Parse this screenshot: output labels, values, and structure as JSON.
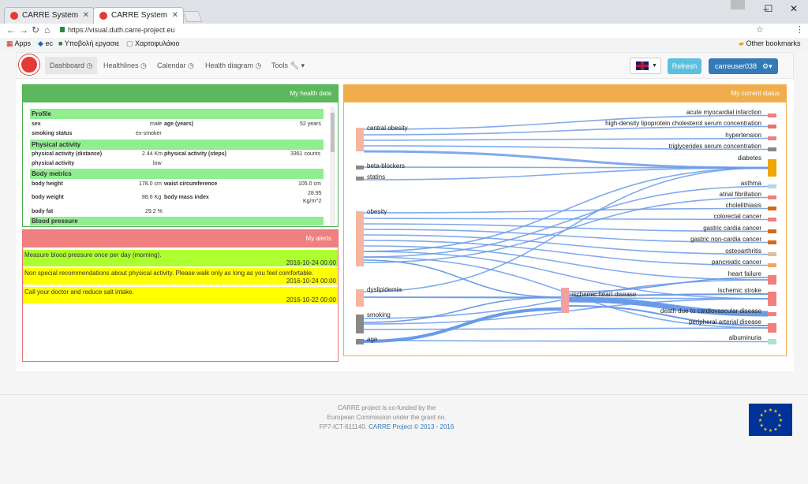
{
  "browser": {
    "tabs": [
      {
        "title": "CARRE System",
        "active": false
      },
      {
        "title": "CARRE System",
        "active": true
      }
    ],
    "url": "https://visual.duth.carre-project.eu",
    "bookmarks": [
      "Apps",
      "ec",
      "Υποβολή εργασιε",
      "Χαρτοφυλάκιο"
    ],
    "other_bookmarks": "Other bookmarks"
  },
  "nav": {
    "items": [
      "Dashboard",
      "Healthlines",
      "Calendar",
      "Health diagram",
      "Tools"
    ],
    "refresh": "Refresh",
    "user": "carreuser038"
  },
  "health": {
    "title": "My health data",
    "sections": {
      "profile": "Profile",
      "activity": "Physical activity",
      "metrics": "Body metrics",
      "bp": "Blood pressure"
    },
    "rows": {
      "sex_l": "sex",
      "sex_v": "male",
      "age_l": "age (years)",
      "age_v": "52 years",
      "smoke_l": "smoking status",
      "smoke_v": "ex-smoker",
      "pad_l": "physical activity (distance)",
      "pad_v": "2.44 Km",
      "pas_l": "physical activity (steps)",
      "pas_v": "3361 counts",
      "pa_l": "physical activity",
      "pa_v": "low",
      "bh_l": "body height",
      "bh_v": "178.0 cm",
      "wc_l": "waist circumference",
      "wc_v": "105.0 cm",
      "bw_l": "body weight",
      "bw_v": "88.6 Kg",
      "bmi_l": "body mass index",
      "bmi_v1": "28.95",
      "bmi_v2": "Kg/m^2",
      "bf_l": "body fat",
      "bf_v": "29.2 %"
    }
  },
  "alerts": {
    "title": "My alerts",
    "items": [
      {
        "text": "Measure blood pressure once per day (morning).",
        "date": "2016-10-24 00:00",
        "color": "#adff2f"
      },
      {
        "text": "Non special recommendations about physical activity. Please walk only as long as you feel comfortable.",
        "date": "2016-10-24 00:00",
        "color": "#ffff00"
      },
      {
        "text": "Call your doctor and reduce salt intake.",
        "date": "2016-10-22 00:00",
        "color": "#ffff00"
      }
    ]
  },
  "status": {
    "title": "My current status",
    "sources": [
      "central obesity",
      "beta-blockers",
      "statins",
      "obesity",
      "dyslipidemia",
      "smoking",
      "age"
    ],
    "middle": "ischemic heart disease",
    "targets": [
      "acute myocardial infarction",
      "high-density lipoprotein cholesterol serum concentration",
      "hypertension",
      "triglycerides serum concentration",
      "diabetes",
      "asthma",
      "atrial fibrillation",
      "cholelithiasis",
      "colorectal cancer",
      "gastric cardia cancer",
      "gastric non-cardia cancer",
      "osteoarthritis",
      "pancreatic cancer",
      "heart failure",
      "ischemic stroke",
      "death due to cardiovascular disease",
      "peripheral arterial disease",
      "albuminuria"
    ]
  },
  "footer": {
    "line1": "CARRE project is co-funded by the",
    "line2": "European Commission under the grant no.",
    "line3a": "FP7-ICT-611140.",
    "line3b": "CARRE Project © 2013 - 2016"
  }
}
